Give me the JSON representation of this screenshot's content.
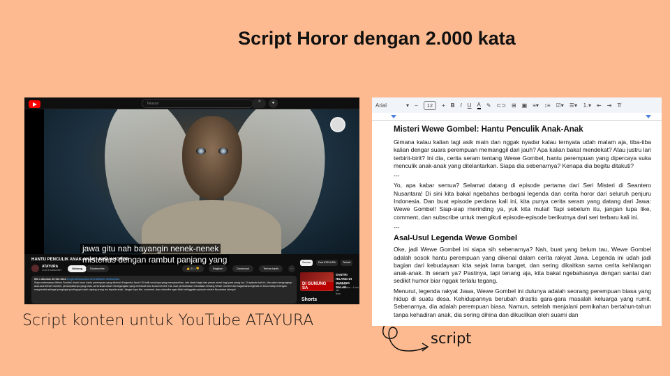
{
  "title": "Script Horor dengan 2.000 kata",
  "caption": "Script konten untuk YouTube ATAYURA",
  "script_label": "script",
  "youtube": {
    "search_placeholder": "Telusuri",
    "subtitle_lines": [
      "jawa gitu nah bayangin nenek-nenek",
      "misterius dengan rambut panjang yang"
    ],
    "video_title": "HANTU PENCULIK ANAK-ANAK - KISAH HOROR",
    "channel": "ATAYURA",
    "subscribers": "41,8 rb subscriber",
    "join": "Gabung",
    "subscribe": "Disubscribe",
    "likes": "21",
    "share": "Bagikan",
    "download": "Download",
    "thanks": "Terima kasih",
    "more": "···",
    "desc_meta": "693 x ditonton  30 Okt 2024",
    "desc_tags": "#LegendaNusantara #CeritaMisteri #MitosJawa",
    "desc_text": "Siapa sebenarnya Wewe Gombel, kisah horor hantu perempuan yang dikenal di legenda Jawa? Di balik sosoknya yang menyeramkan, ada kisah tragis dan pesan moral bagi para orang tua. Di episode kali ini, kita akan mengungkap asal-usul Wewe Gombel, penampilannya yang khas, serta kisah-kisah menegangkan yang membuat bulu kuduk berdiri! Yuk, ikuti pembahasan mendalam tentang Wewe Gombel dan bagaimana legenda ini terus hidup di tengah masyarakat sebagai pengingat pentingnya kasih sayang orang tua kepada anak. Jangan lupa like, comment, dan subscribe agar tidak ketinggalan episode misteri Nusantara lainnya!",
    "chips": [
      "Semua",
      "Dari ATAYURA",
      "Terkait"
    ],
    "rec_thumb_text": "DI GUNUNG SA",
    "rec_title": "SANTRI HILANG DI GUNUNG SALAK",
    "rec_channel": "ATAYURA",
    "rec_meta": "234 x ditonton · 4 hari lalu",
    "rec_badge": "Baru",
    "shorts": "Shorts"
  },
  "doc": {
    "toolbar": {
      "font": "Arial",
      "font_size": "12"
    },
    "heading": "Misteri Wewe Gombel: Hantu Penculik Anak-Anak",
    "p1": "Gimana kalau kalian lagi asik main dan nggak nyadar kalau ternyata udah malam aja, tiba-tiba kalian dengar suara perempuan memanggil dari jauh? Apa kalian bakal mendekat? Atau justru lari terbirit-birit? Ini dia, cerita seram tentang Wewe Gombel, hantu perempuan yang dipercaya suka menculik anak-anak yang ditelantarkan. Siapa dia sebenarnya? Kenapa dia begitu ditakuti?",
    "sep1": "---",
    "p2": "Yo, apa kabar semua? Selamat datang di episode pertama dari Seri Misteri di Seantero Nusantara! Di sini kita bakal ngebahas berbagai legenda dan cerita horor dari seluruh penjuru Indonesia. Dan buat episode perdana kali ini, kita punya cerita seram yang datang dari Jawa: Wewe Gombel! Siap-siap merinding ya, yuk kita mulai! Tapi sebelum itu, jangan lupa like, comment, dan subscribe untuk mengikuti episode-episode berikutnya dari seri terbaru kali ini.",
    "sep2": "---",
    "heading2": "Asal-Usul Legenda Wewe Gombel",
    "p3": "Oke, jadi Wewe Gombel ini siapa sih sebenarnya? Nah, buat yang belum tau, Wewe Gombel adalah sosok hantu perempuan yang dikenal dalam cerita rakyat Jawa. Legenda ini udah jadi bagian dari kebudayaan kita sejak lama banget, dan sering dikaitkan sama cerita kehilangan anak-anak. Ih seram ya? Pastinya, tapi tenang aja, kita bakal ngebahasnya dengan santai dan sedikit humor biar nggak terlalu tegang.",
    "p4": "Menurut, legenda rakyat Jawa, Wewe Gombel ini dulunya adalah seorang perempuan biasa yang hidup di suatu desa. Kehidupannya berubah drastis gara-gara masalah keluarga yang rumit. Sebenarnya, dia adalah perempuan biasa. Namun, setelah menjalani pernikahan bertahun-tahun tanpa kehadiran anak, dia sering dihina dan dikucilkan oleh suami dan"
  }
}
